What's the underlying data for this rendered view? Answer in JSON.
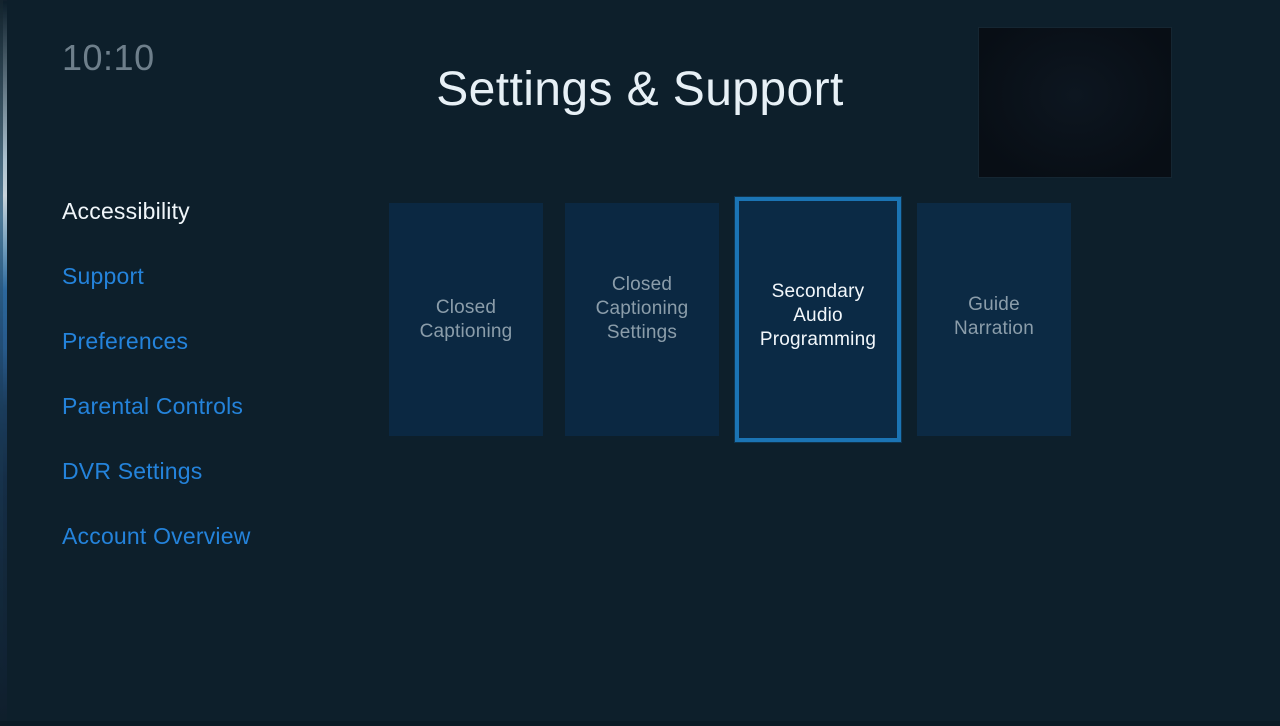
{
  "status_bar": {
    "clock": "10:10"
  },
  "header": {
    "title": "Settings & Support"
  },
  "pip": {
    "name": "video-preview"
  },
  "sidebar": {
    "items": [
      {
        "label": "Accessibility",
        "key": "accessibility",
        "active": true
      },
      {
        "label": "Support",
        "key": "support",
        "active": false
      },
      {
        "label": "Preferences",
        "key": "preferences",
        "active": false
      },
      {
        "label": "Parental Controls",
        "key": "parental-controls",
        "active": false
      },
      {
        "label": "DVR Settings",
        "key": "dvr-settings",
        "active": false
      },
      {
        "label": "Account Overview",
        "key": "account-overview",
        "active": false
      }
    ]
  },
  "tiles": [
    {
      "label": "Closed\nCaptioning",
      "key": "closed-captioning",
      "selected": false
    },
    {
      "label": "Closed\nCaptioning\nSettings",
      "key": "closed-captioning-settings",
      "selected": false
    },
    {
      "label": "Secondary\nAudio\nProgramming",
      "key": "secondary-audio-programming",
      "selected": true
    },
    {
      "label": "Guide\nNarration",
      "key": "guide-narration",
      "selected": false
    }
  ],
  "colors": {
    "background": "#0d1f2b",
    "tile_fill": "#0b2842",
    "selection_border": "#1b74b4",
    "link_blue": "#2483db",
    "active_text": "#f0f6fa",
    "muted_text": "#8b9daa",
    "clock_text": "#6e7f8b"
  }
}
